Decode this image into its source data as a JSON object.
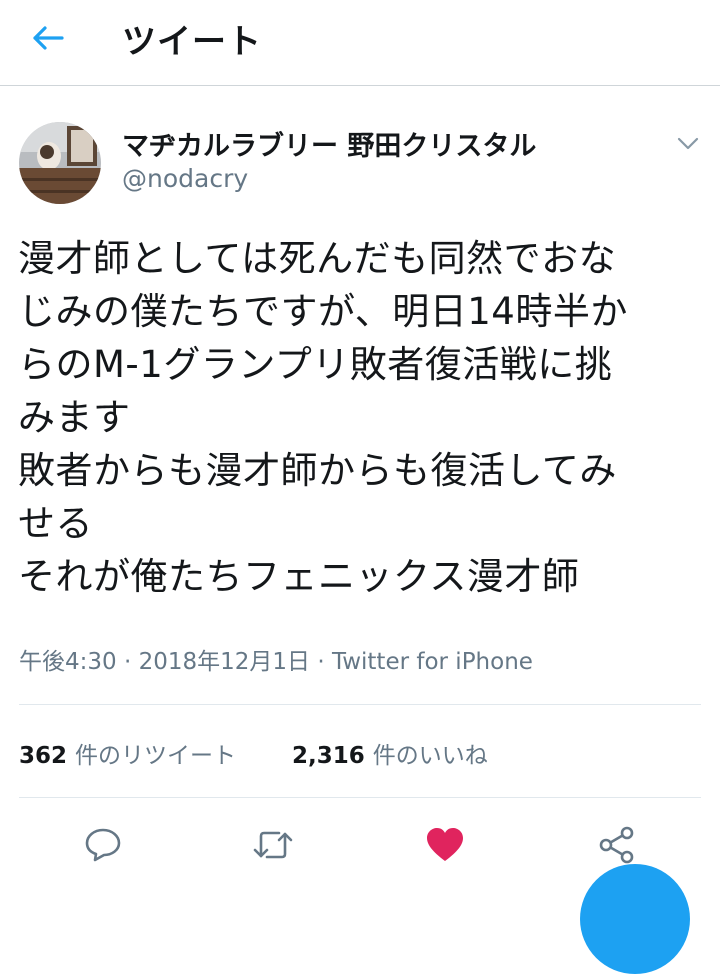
{
  "header": {
    "title": "ツイート",
    "back_icon": "arrow-left-icon"
  },
  "user": {
    "display_name": "マヂカルラブリー 野田クリスタル",
    "handle": "@nodacry"
  },
  "tweet": {
    "lines": [
      "漫才師としては死んだも同然でおな",
      "じみの僕たちですが、明日14時半か",
      "らのM-1グランプリ敗者復活戦に挑",
      "みます",
      "敗者からも漫才師からも復活してみ",
      "せる",
      "それが俺たちフェニックス漫才師"
    ],
    "time": "午後4:30",
    "date": "2018年12月1日",
    "source": "Twitter for iPhone",
    "separator": " · "
  },
  "stats": {
    "retweets_count": "362",
    "retweets_label": "件のリツイート",
    "likes_count": "2,316",
    "likes_label": "件のいいね"
  },
  "colors": {
    "accent": "#1da1f2",
    "like": "#e0245e",
    "secondary_text": "#657786",
    "icon_gray": "#657786"
  },
  "icons": {
    "reply": "reply-icon",
    "retweet": "retweet-icon",
    "like": "heart-icon",
    "share": "share-icon",
    "menu": "chevron-down-icon"
  }
}
